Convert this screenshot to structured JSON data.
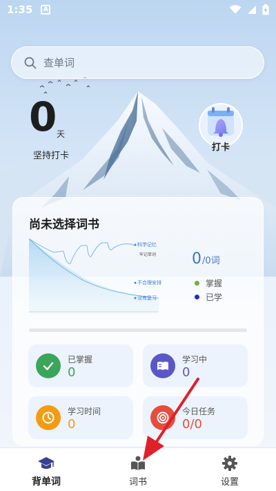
{
  "status_bar": {
    "time": "1:35",
    "notification_icon": "A"
  },
  "search": {
    "placeholder": "查单词"
  },
  "streak": {
    "value": "0",
    "unit": "天",
    "label": "坚持打卡"
  },
  "checkin": {
    "label": "打卡"
  },
  "book": {
    "title": "尚未选择词书",
    "count": "0",
    "total": "/0词",
    "curve_labels": [
      "科学记忆",
      "牢记单词",
      "不合理安排",
      "没有复习"
    ],
    "legend": [
      {
        "label": "掌握",
        "color": "#6ab04c"
      },
      {
        "label": "已学",
        "color": "#1f2bd6"
      }
    ]
  },
  "stats": [
    {
      "label": "已掌握",
      "value": "0",
      "color": "#3ba55c",
      "icon": "check-icon"
    },
    {
      "label": "学习中",
      "value": "0",
      "color": "#5a58c7",
      "icon": "book-open-icon"
    },
    {
      "label": "学习时间",
      "value": "0",
      "color": "#f39c12",
      "icon": "clock-icon"
    },
    {
      "label": "今日任务",
      "value": "0/0",
      "color": "#e74c3c",
      "icon": "target-icon"
    }
  ],
  "bottom_nav": [
    {
      "label": "背单词",
      "icon": "graduation-cap-icon",
      "active": true
    },
    {
      "label": "词书",
      "icon": "book-reader-icon",
      "active": false
    },
    {
      "label": "设置",
      "icon": "gear-icon",
      "active": false
    }
  ],
  "colors": {
    "accent": "#3c73c9",
    "annotation_arrow": "#e0202a"
  }
}
